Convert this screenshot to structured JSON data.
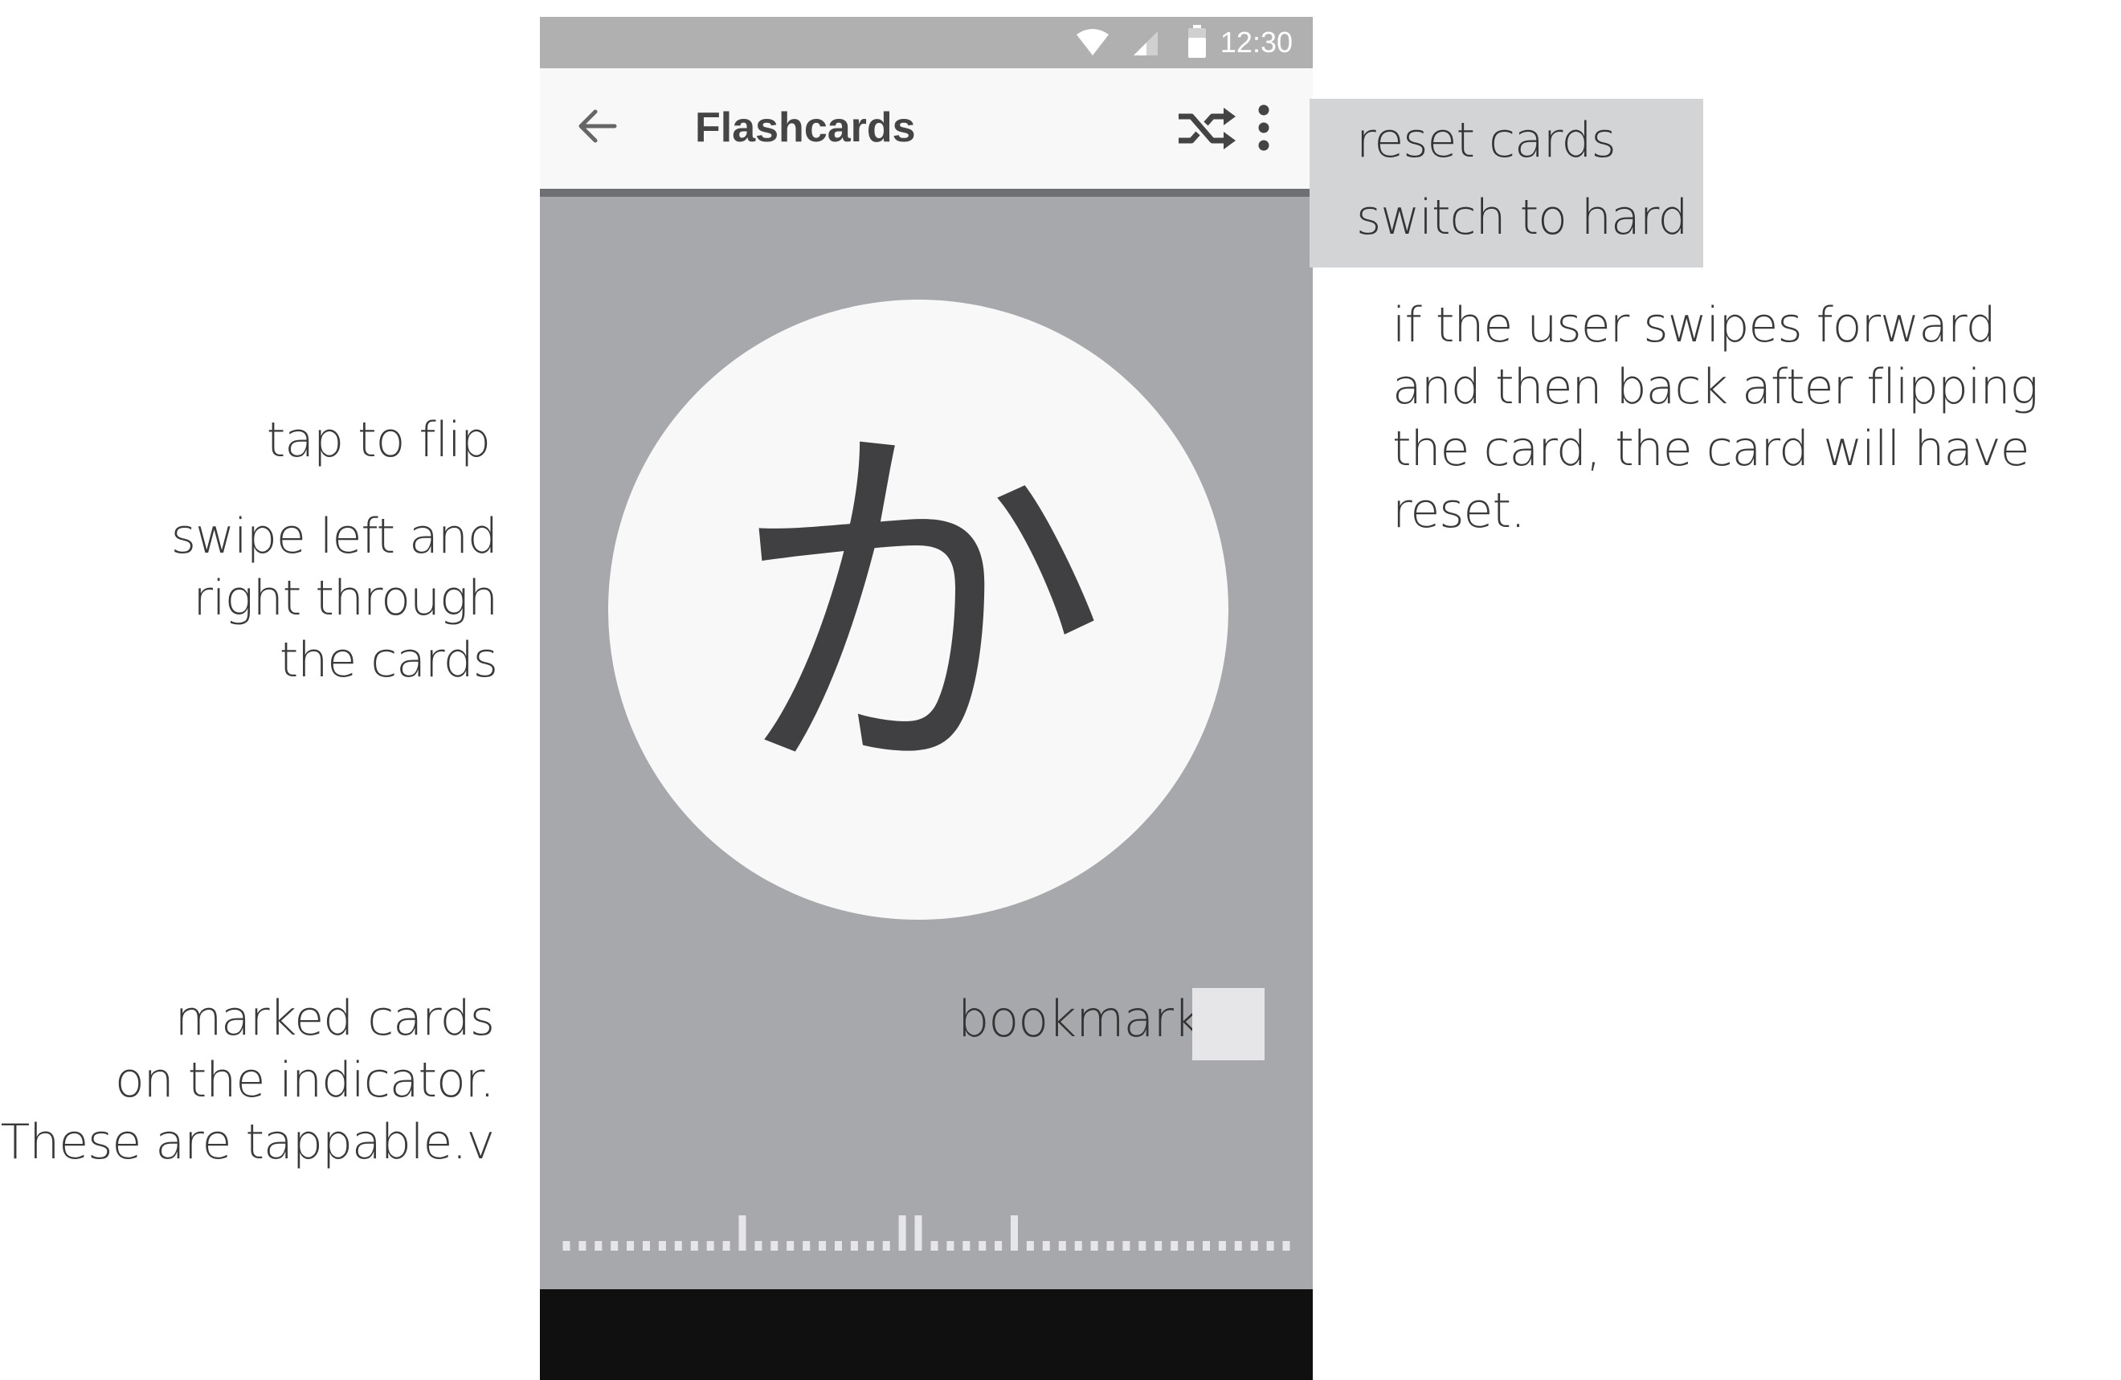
{
  "status_bar": {
    "time": "12:30"
  },
  "app_bar": {
    "title": "Flashcards"
  },
  "card": {
    "glyph": "か"
  },
  "bookmark": {
    "label": "bookmark",
    "checked": false
  },
  "overflow_menu": {
    "items": [
      "reset cards",
      "switch to hard"
    ]
  },
  "progress_indicator": {
    "total_cards": 46,
    "marked_cards": [
      11,
      21,
      22,
      28
    ]
  },
  "annotations": {
    "tap": "tap to flip",
    "swipe": "swipe left and\nright through \nthe cards",
    "marked": "marked cards\non the indicator.\nThese are tappable.v",
    "reset": "if the user swipes forward\nand then back after flipping\nthe card, the card will have reset."
  },
  "colors": {
    "screen_bg": "#a7a8ab",
    "status_bar": "#b0b0b0",
    "app_bar": "#f8f8f8",
    "card": "#f8f8f8",
    "glyph": "#404042",
    "menu": "#d3d4d6",
    "indicator": "#e6e6e8",
    "nav_bar": "#101010"
  }
}
